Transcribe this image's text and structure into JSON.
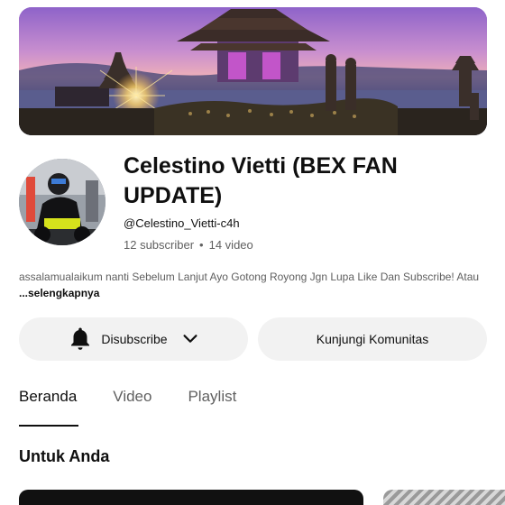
{
  "channel": {
    "name": "Celestino Vietti (BEX FAN UPDATE)",
    "handle": "@Celestino_Vietti-c4h",
    "subscribers": "12 subscriber",
    "separator": "•",
    "videos": "14 video",
    "description": "assalamualaikum nanti Sebelum Lanjut Ayo Gotong Royong Jgn Lupa Like Dan Subscribe! Atau ",
    "more_label": "...selengkapnya"
  },
  "actions": {
    "subscribe_label": "Disubscribe",
    "community_label": "Kunjungi Komunitas"
  },
  "tabs": [
    {
      "label": "Beranda",
      "active": true
    },
    {
      "label": "Video",
      "active": false
    },
    {
      "label": "Playlist",
      "active": false
    }
  ],
  "section": {
    "title": "Untuk Anda"
  },
  "icons": {
    "bell": "bell-icon",
    "chevron": "chevron-down-icon"
  }
}
